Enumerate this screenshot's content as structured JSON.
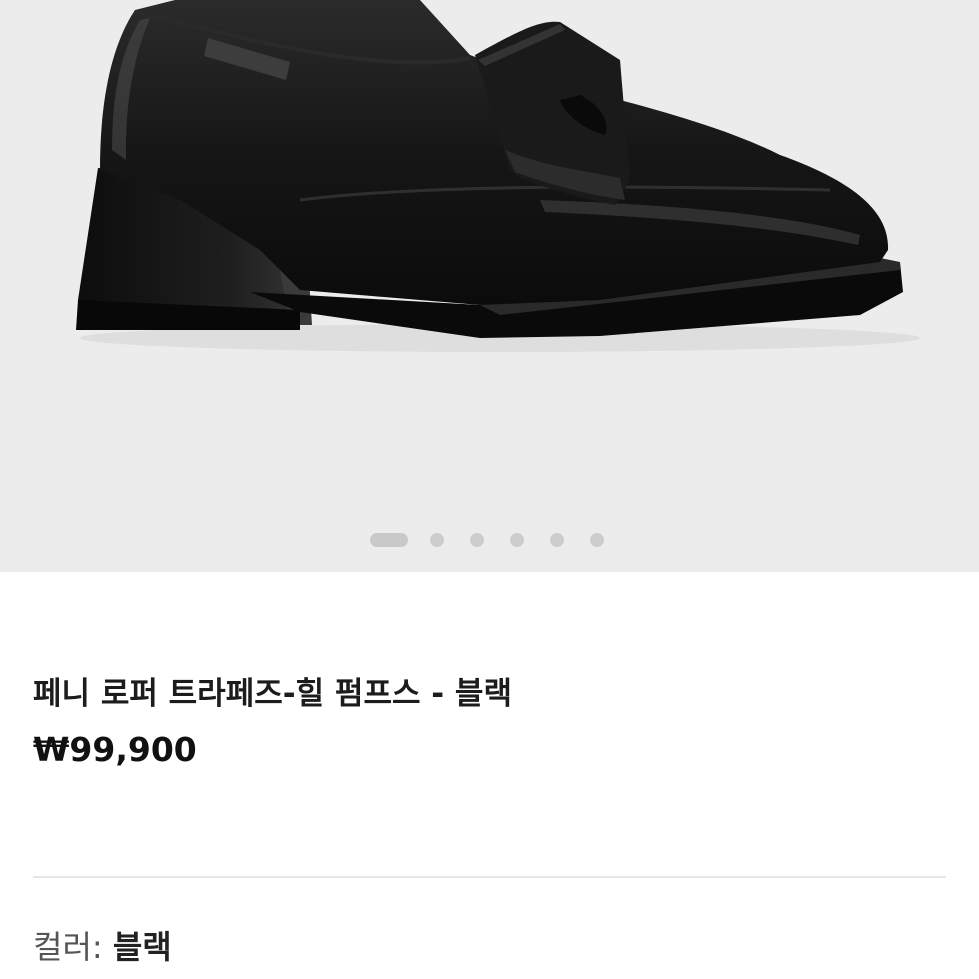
{
  "product": {
    "title": "페니 로퍼 트라페즈-힐 펌프스 - 블랙",
    "price": "₩99,900",
    "color_label": "컬러:",
    "color_value": "블랙"
  },
  "gallery": {
    "total_images": 6,
    "active_index": 0,
    "image_icon": "loafer-shoe-image"
  },
  "colors": {
    "gallery_background": "#ececec",
    "shoe": "#141414"
  }
}
